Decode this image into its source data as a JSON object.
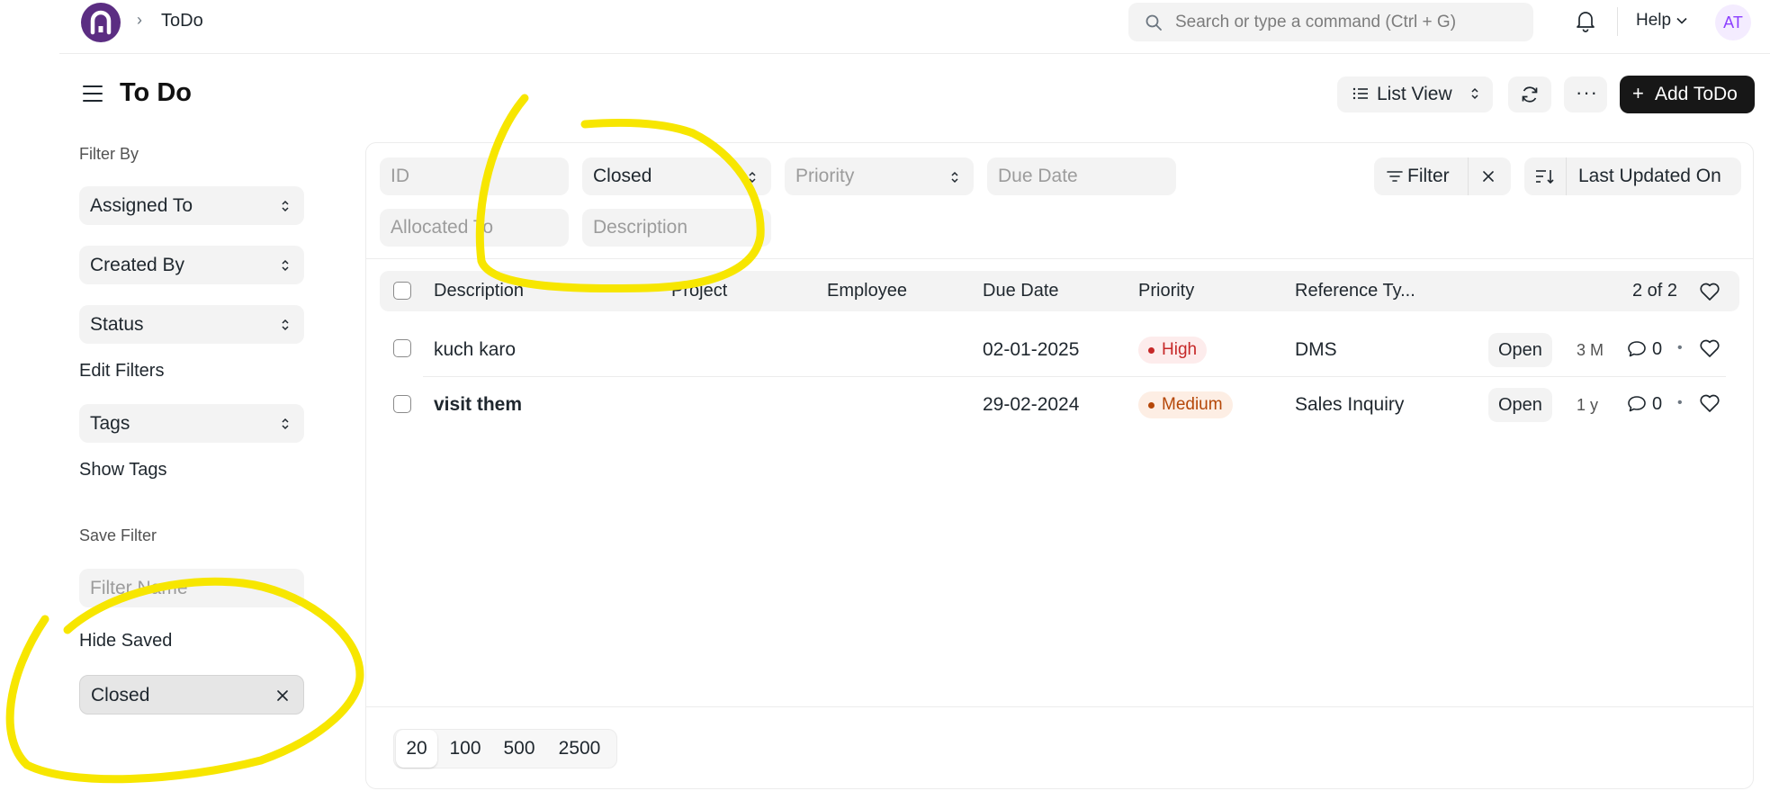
{
  "topbar": {
    "breadcrumb": "ToDo",
    "search_placeholder": "Search or type a command (Ctrl + G)",
    "help_label": "Help",
    "avatar_initials": "AT"
  },
  "header": {
    "title": "To Do",
    "list_view_label": "List View",
    "add_label": "Add ToDo"
  },
  "sidebar": {
    "filter_by_label": "Filter By",
    "filters": [
      "Assigned To",
      "Created By",
      "Status"
    ],
    "edit_filters_label": "Edit Filters",
    "tags_label": "Tags",
    "show_tags_label": "Show Tags",
    "save_filter_label": "Save Filter",
    "filter_name_placeholder": "Filter Name",
    "hide_saved_label": "Hide Saved",
    "saved_filters": [
      "Closed"
    ]
  },
  "filters": {
    "id_placeholder": "ID",
    "status_value": "Closed",
    "priority_placeholder": "Priority",
    "due_date_placeholder": "Due Date",
    "allocated_placeholder": "Allocated To",
    "description_placeholder": "Description",
    "filter_label": "Filter",
    "sort_label": "Last Updated On"
  },
  "table": {
    "columns": [
      "Description",
      "Project",
      "Employee",
      "Due Date",
      "Priority",
      "Reference Ty..."
    ],
    "count": "2 of 2",
    "rows": [
      {
        "description": "kuch karo",
        "due_date": "02-01-2025",
        "priority": "High",
        "reference_type": "DMS",
        "status": "Open",
        "age": "3 M",
        "comments": "0"
      },
      {
        "description": "visit them",
        "due_date": "29-02-2024",
        "priority": "Medium",
        "reference_type": "Sales Inquiry",
        "status": "Open",
        "age": "1 y",
        "comments": "0"
      }
    ]
  },
  "pagination": {
    "sizes": [
      "20",
      "100",
      "500",
      "2500"
    ],
    "selected": "20"
  },
  "colors": {
    "brand": "#5b2d82",
    "primary_button": "#171717",
    "annotation": "#f7e600",
    "priority_high": "#c62828",
    "priority_medium": "#b54708"
  }
}
